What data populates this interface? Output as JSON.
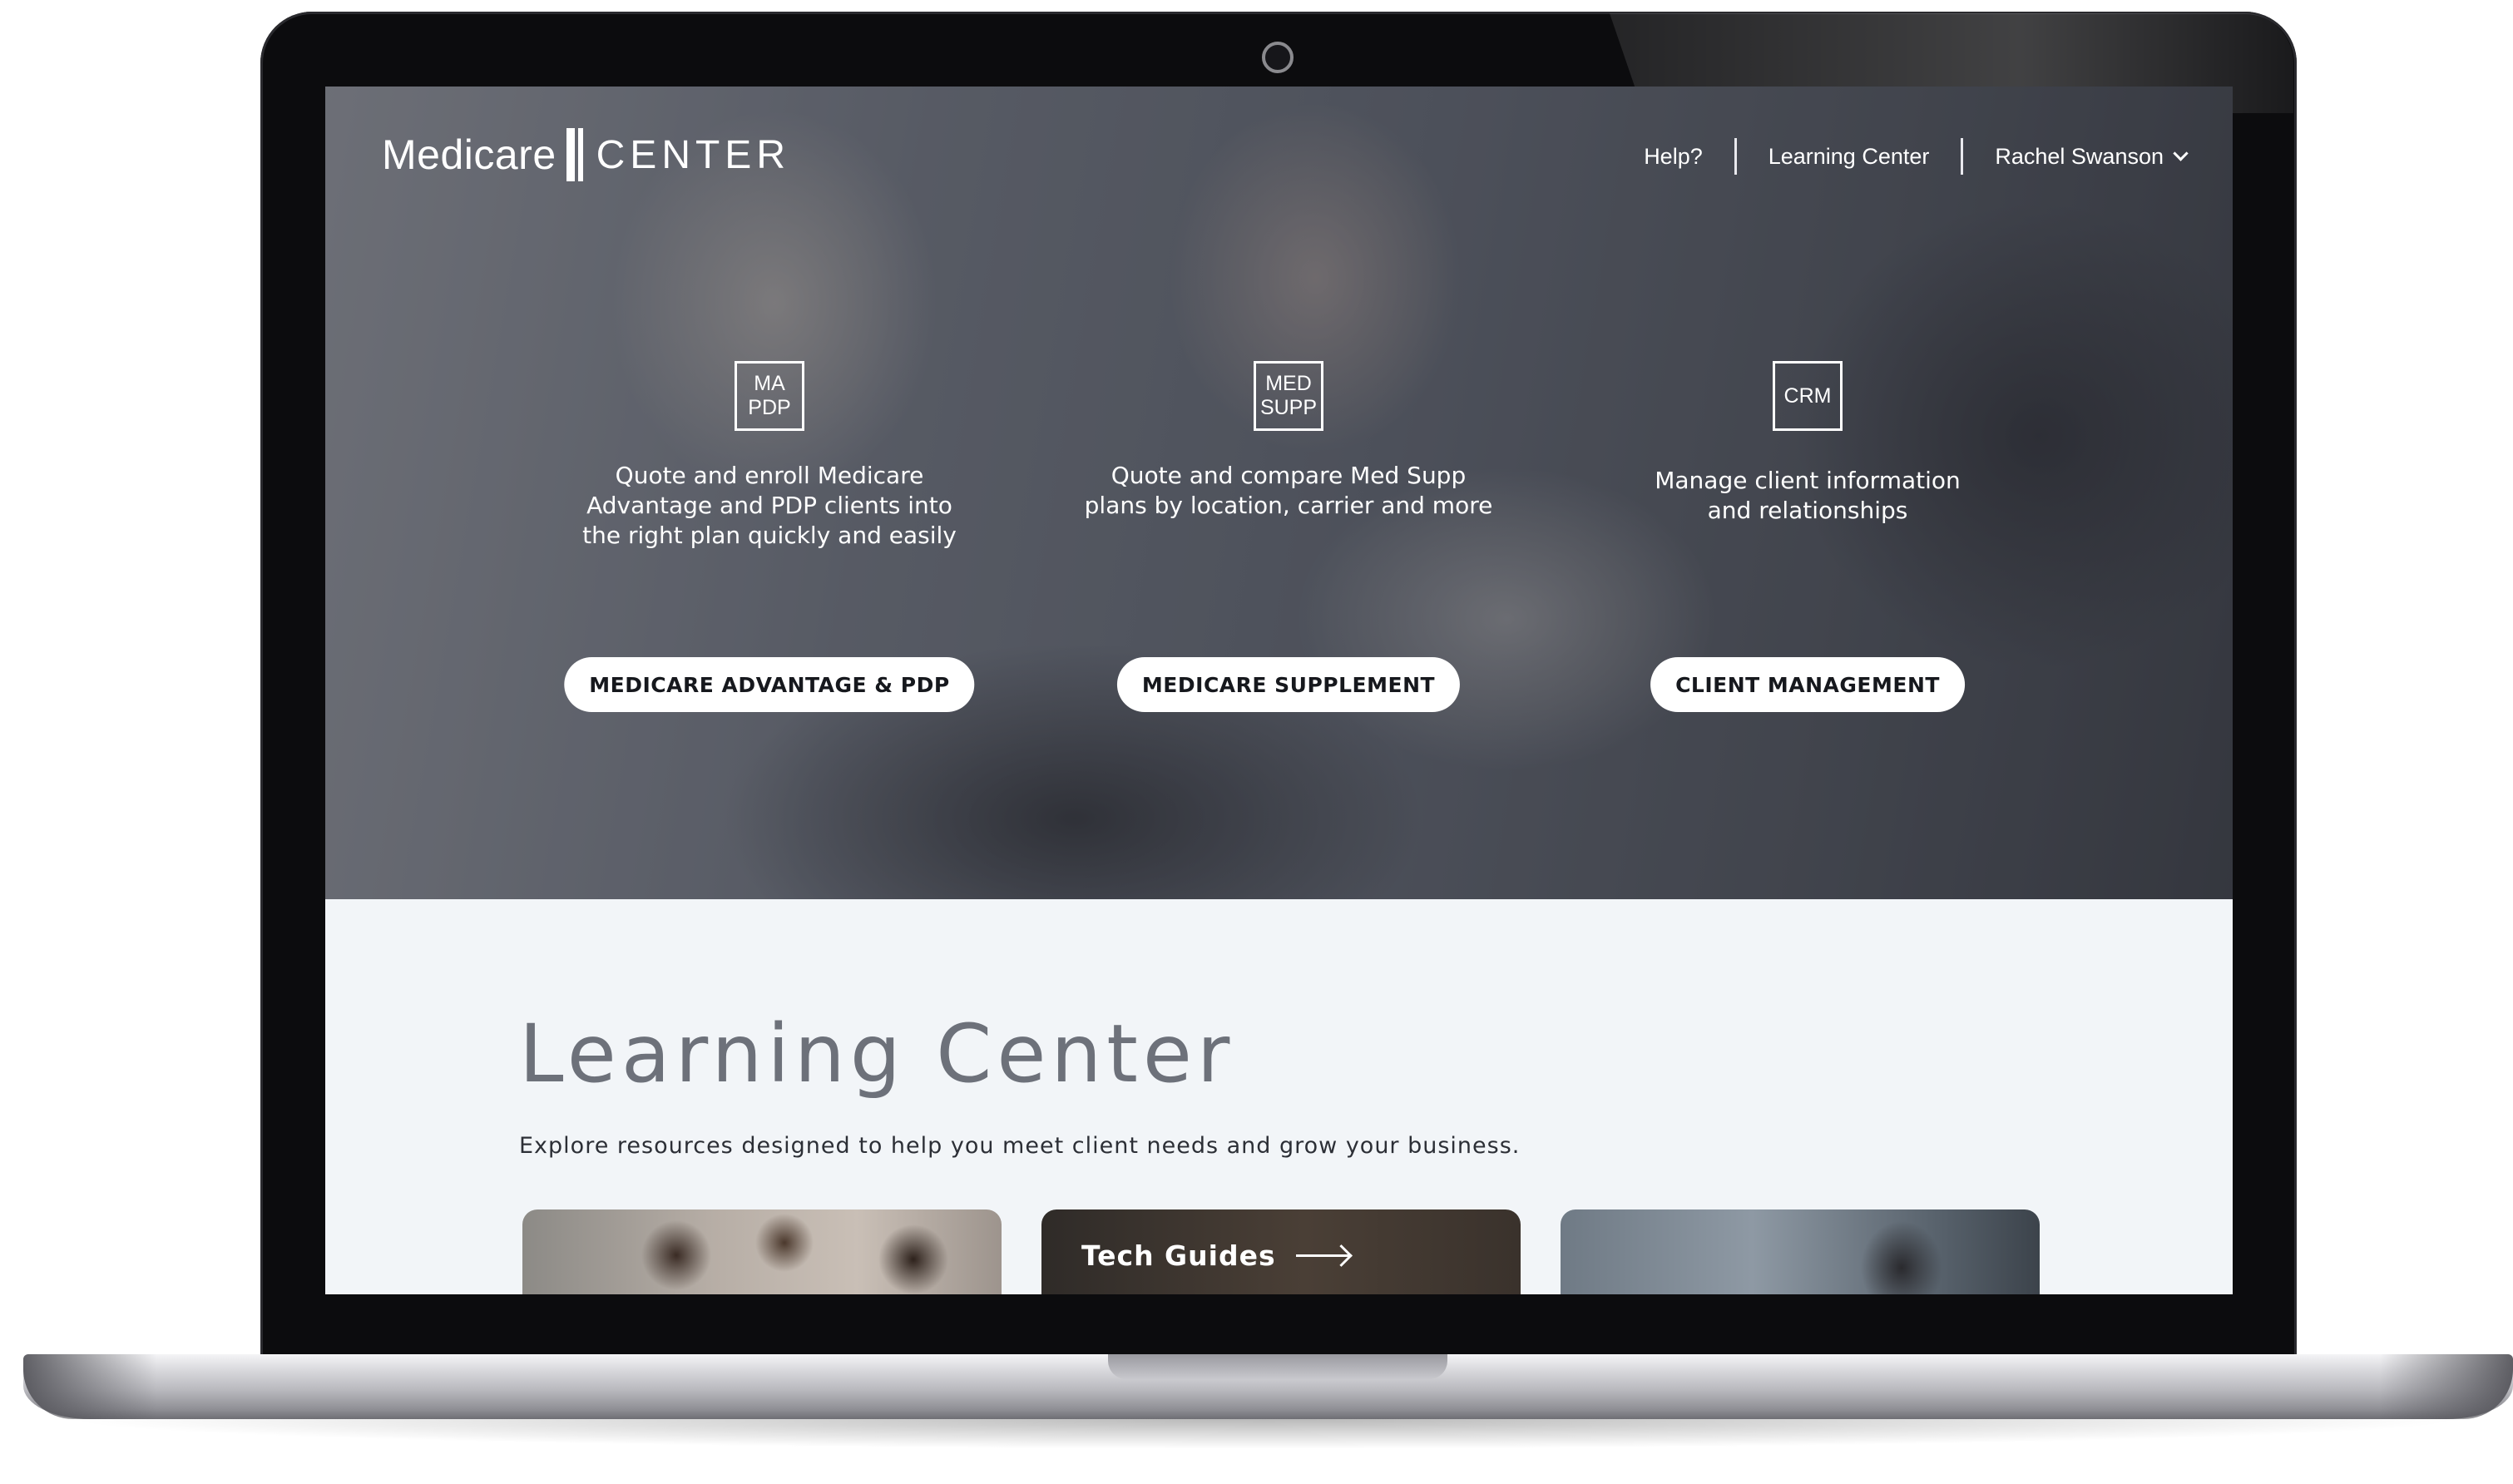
{
  "site": {
    "logo": {
      "word": "Medicare",
      "center": "CENTER"
    },
    "nav": {
      "help": "Help?",
      "learning_center": "Learning Center",
      "user_name": "Rachel Swanson"
    }
  },
  "features": [
    {
      "icon_text": "MA\nPDP",
      "description": "Quote and enroll Medicare\nAdvantage and PDP clients into\nthe right plan quickly and easily",
      "button": "MEDICARE ADVANTAGE & PDP"
    },
    {
      "icon_text": "MED\nSUPP",
      "description": "Quote and compare Med Supp\nplans by location, carrier and more",
      "button": "MEDICARE SUPPLEMENT"
    },
    {
      "icon_text": "CRM",
      "description": "Manage client information\nand relationships",
      "button": "CLIENT MANAGEMENT"
    }
  ],
  "learning_center": {
    "title": "Learning Center",
    "subtitle": "Explore resources designed to help you meet client needs and grow your business.",
    "cards": [
      {
        "label": ""
      },
      {
        "label": "Tech Guides"
      },
      {
        "label": ""
      }
    ]
  },
  "colors": {
    "hero_overlay": "#2c2f36",
    "content_background": "#f2f5f8",
    "title_gray": "#6d717a",
    "button_bg": "#ffffff",
    "button_text": "#16181d"
  },
  "icons": [
    "chevron-down-icon",
    "arrow-right-icon"
  ]
}
